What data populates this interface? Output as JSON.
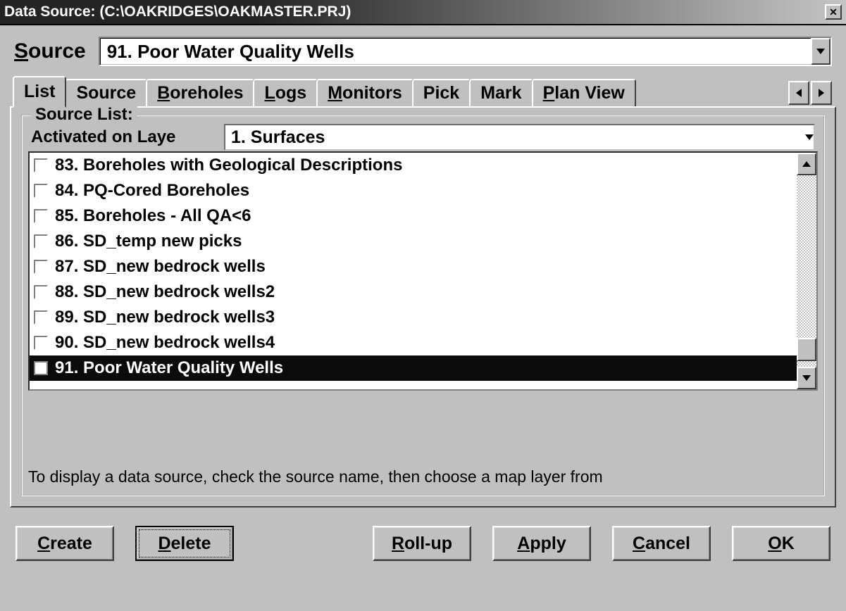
{
  "window": {
    "title": "Data Source: (C:\\OAKRIDGES\\OAKMASTER.PRJ)"
  },
  "source": {
    "label": "Source",
    "selected": "91. Poor Water Quality Wells"
  },
  "tabs": [
    {
      "label": "List",
      "accel": "",
      "active": true
    },
    {
      "label": "Source",
      "accel": "",
      "active": false
    },
    {
      "label": "Boreholes",
      "accel": "B",
      "active": false
    },
    {
      "label": "Logs",
      "accel": "L",
      "active": false
    },
    {
      "label": "Monitors",
      "accel": "M",
      "active": false
    },
    {
      "label": "Pick",
      "accel": "",
      "active": false
    },
    {
      "label": "Mark",
      "accel": "",
      "active": false
    },
    {
      "label": "Plan View",
      "accel": "P",
      "active": false
    }
  ],
  "group": {
    "legend": "Source List:",
    "layer_label": "Activated on Laye",
    "layer_value": "1. Surfaces"
  },
  "list": {
    "items": [
      {
        "num": "83",
        "label": "Boreholes with Geological Descriptions",
        "checked": false,
        "selected": false
      },
      {
        "num": "84",
        "label": "PQ-Cored Boreholes",
        "checked": false,
        "selected": false
      },
      {
        "num": "85",
        "label": "Boreholes - All QA<6",
        "checked": false,
        "selected": false
      },
      {
        "num": "86",
        "label": "SD_temp new picks",
        "checked": false,
        "selected": false
      },
      {
        "num": "87",
        "label": "SD_new bedrock wells",
        "checked": false,
        "selected": false
      },
      {
        "num": "88",
        "label": "SD_new bedrock wells2",
        "checked": false,
        "selected": false
      },
      {
        "num": "89",
        "label": "SD_new bedrock wells3",
        "checked": false,
        "selected": false
      },
      {
        "num": "90",
        "label": "SD_new bedrock wells4",
        "checked": false,
        "selected": false
      },
      {
        "num": "91",
        "label": "Poor Water Quality Wells",
        "checked": false,
        "selected": true
      }
    ]
  },
  "hint": "To display a data source, check the source name, then choose a map layer from",
  "buttons": {
    "create": "Create",
    "delete": "Delete",
    "rollup": "Roll-up",
    "apply": "Apply",
    "cancel": "Cancel",
    "ok": "OK"
  }
}
